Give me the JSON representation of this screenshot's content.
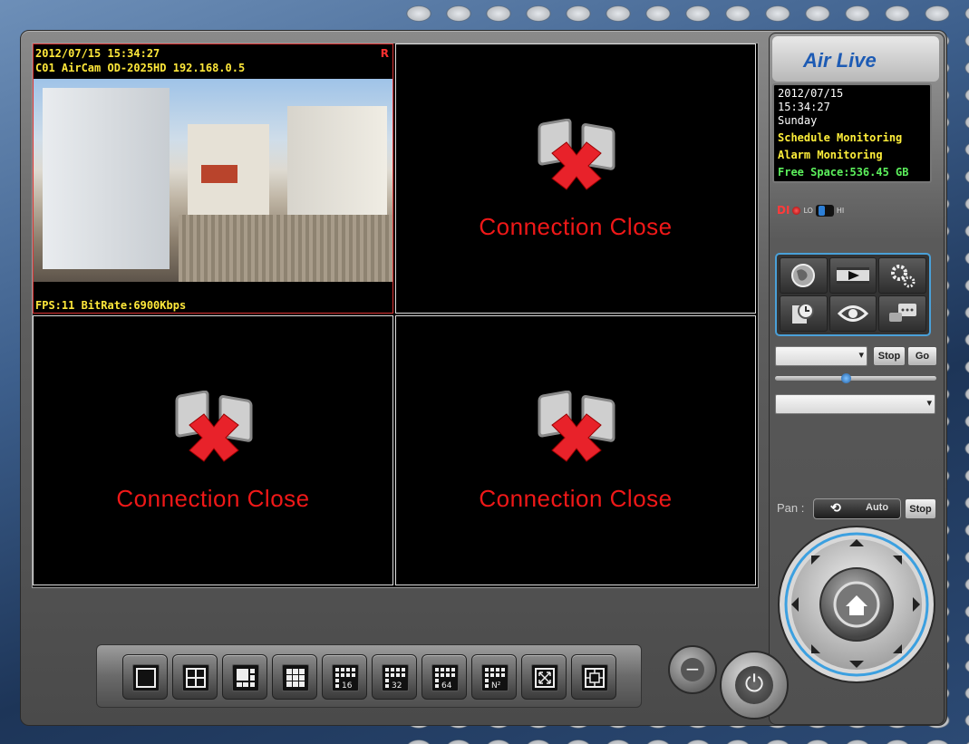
{
  "cameras": [
    {
      "osd_datetime": "2012/07/15 15:34:27",
      "osd_name": "C01 AirCam OD-2025HD 192.168.0.5",
      "rec_flag": "R",
      "stats": "FPS:11 BitRate:6900Kbps"
    },
    {
      "status": "Connection Close"
    },
    {
      "status": "Connection Close"
    },
    {
      "status": "Connection Close"
    }
  ],
  "brand": {
    "logo_text": "Air Live"
  },
  "info": {
    "date": "2012/07/15",
    "time": "15:34:27",
    "weekday": "Sunday",
    "schedule": "Schedule Monitoring",
    "alarm": "Alarm Monitoring",
    "free_space": "Free Space:536.45 GB"
  },
  "di": {
    "label": "DI",
    "lo": "LO",
    "hi": "HI"
  },
  "function_buttons": [
    "globe-icon",
    "playback-icon",
    "settings-gears-icon",
    "schedule-clock-icon",
    "eye-icon",
    "message-icon"
  ],
  "preset": {
    "stop_label": "Stop",
    "go_label": "Go"
  },
  "pan": {
    "label": "Pan :",
    "auto_label": "Auto",
    "stop_label": "Stop"
  },
  "layouts": [
    "single-view-icon",
    "quad-view-icon",
    "six-view-icon",
    "nine-view-icon",
    "16",
    "32",
    "64",
    "N²",
    "fullscreen-icon",
    "auto-cycle-icon"
  ],
  "colors": {
    "connection_close": "#f01818",
    "osd": "#ffe83a",
    "free_space": "#5cf05c",
    "accent": "#4aa0d8"
  }
}
